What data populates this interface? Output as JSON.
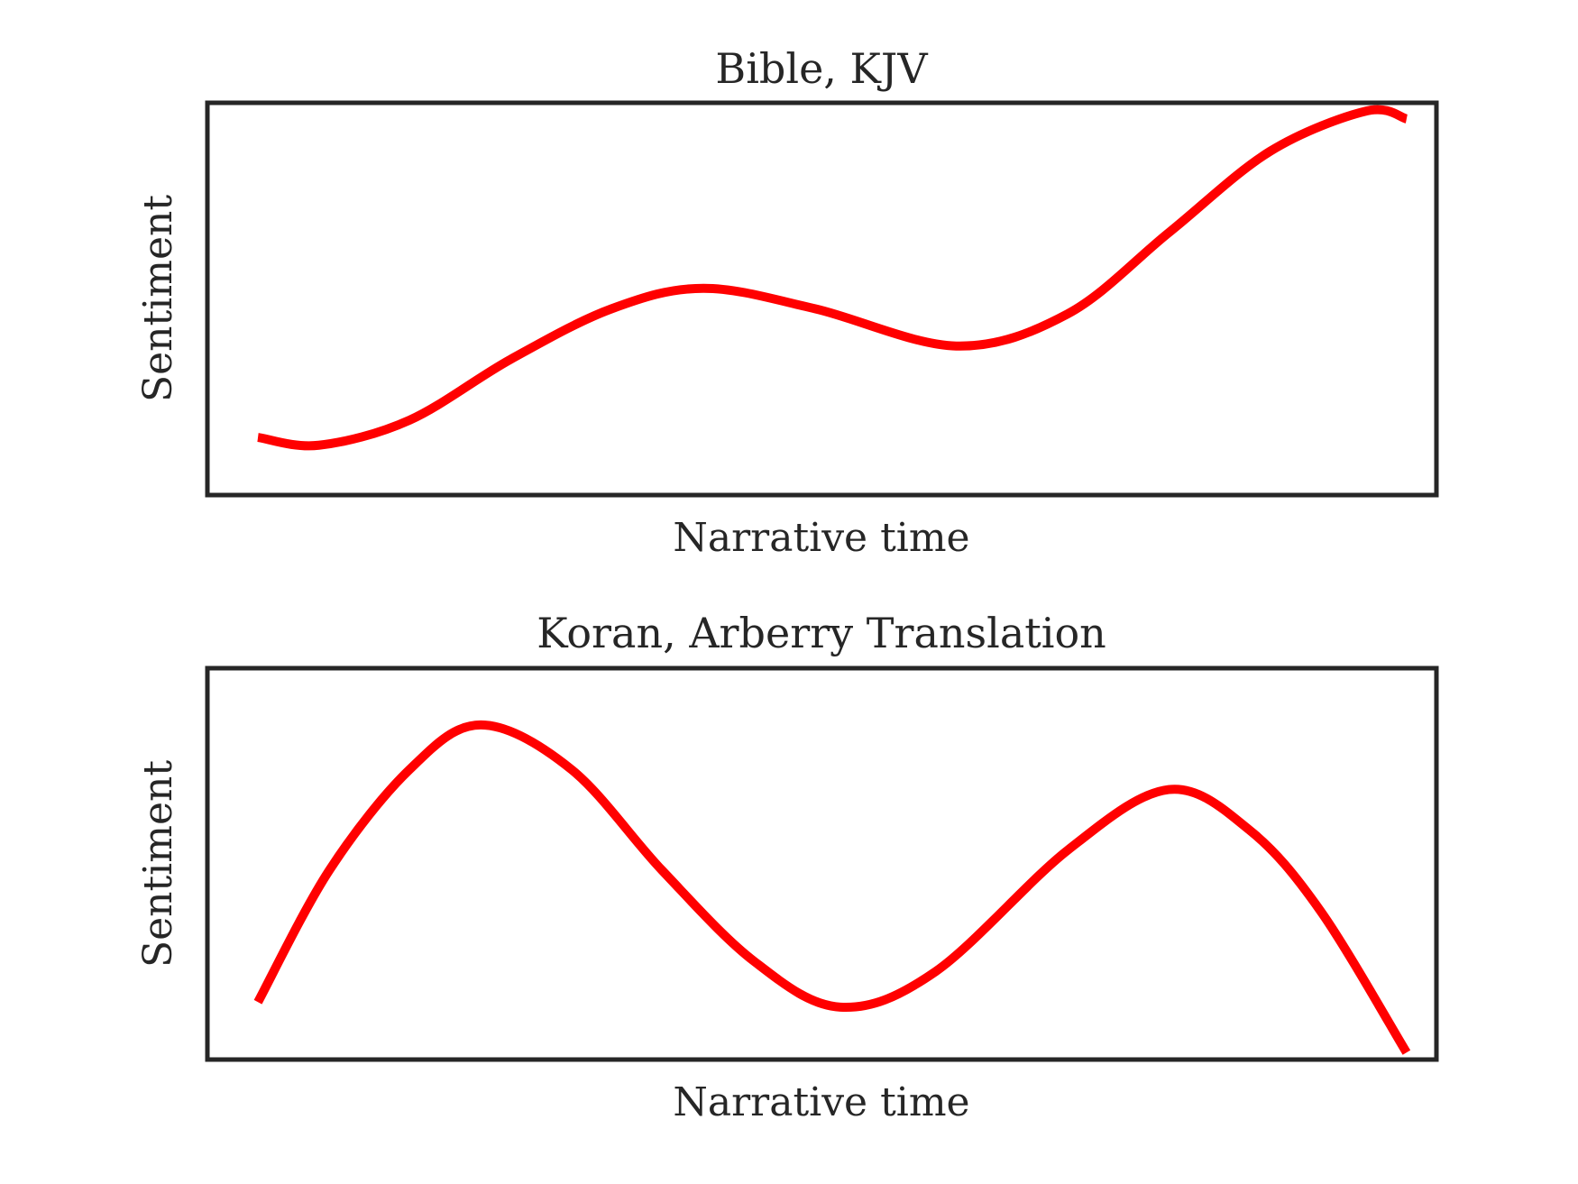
{
  "chart_data": [
    {
      "type": "line",
      "title": "Bible, KJV",
      "xlabel": "Narrative time",
      "ylabel": "Sentiment",
      "xlim": [
        -0.044,
        1.026
      ],
      "ylim": [
        0,
        1
      ],
      "grid": false,
      "color": "#ff0000",
      "frame_color": "#262626",
      "x": [
        0,
        0.053,
        0.132,
        0.22,
        0.308,
        0.388,
        0.485,
        0.608,
        0.705,
        0.793,
        0.881,
        0.965,
        1.0
      ],
      "y": [
        0.147,
        0.127,
        0.191,
        0.346,
        0.475,
        0.527,
        0.475,
        0.38,
        0.462,
        0.669,
        0.876,
        0.979,
        0.959
      ]
    },
    {
      "type": "line",
      "title": "Koran, Arberry Translation",
      "xlabel": "Narrative time",
      "ylabel": "Sentiment",
      "xlim": [
        -0.044,
        1.026
      ],
      "ylim": [
        0,
        1
      ],
      "grid": false,
      "color": "#ff0000",
      "frame_color": "#262626",
      "x": [
        0,
        0.062,
        0.132,
        0.194,
        0.273,
        0.352,
        0.432,
        0.507,
        0.59,
        0.705,
        0.793,
        0.863,
        0.925,
        1.0
      ],
      "y": [
        0.147,
        0.483,
        0.741,
        0.855,
        0.741,
        0.483,
        0.251,
        0.134,
        0.225,
        0.535,
        0.69,
        0.587,
        0.38,
        0.018
      ]
    }
  ]
}
